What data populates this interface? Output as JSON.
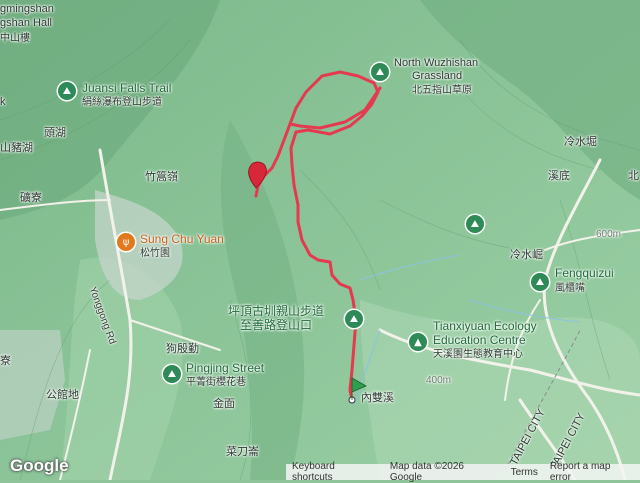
{
  "map": {
    "brand": "Google",
    "attribution": {
      "shortcuts": "Keyboard shortcuts",
      "data": "Map data ©2026 Google",
      "terms": "Terms",
      "report": "Report a map error"
    },
    "colors": {
      "track": "#e5394f",
      "start_flag": "#2e9e4f",
      "end_pin": "#d7283a",
      "terrain": "#8fc49b"
    }
  },
  "labels": [
    {
      "id": "nl-tl1",
      "text": "gmingshan",
      "cls": ""
    },
    {
      "id": "nl-tl2",
      "text": "gshan Hall",
      "cls": ""
    },
    {
      "id": "nl-tl3",
      "text": "中山樓",
      "cls": "sub"
    },
    {
      "id": "juansi-en",
      "text": "Juansi Falls Trail",
      "cls": "green"
    },
    {
      "id": "juansi-zh",
      "text": "絹絲瀑布登山步道",
      "cls": "sub"
    },
    {
      "id": "k",
      "text": "k",
      "cls": ""
    },
    {
      "id": "toukou",
      "text": "頭湖",
      "cls": ""
    },
    {
      "id": "shanzhuhu",
      "text": "山豬湖",
      "cls": ""
    },
    {
      "id": "zhugaoling",
      "text": "竹篙嶺",
      "cls": ""
    },
    {
      "id": "jianliao",
      "text": "礦寮",
      "cls": ""
    },
    {
      "id": "songzhu-en",
      "text": "Sung Chu Yuan",
      "cls": "orange"
    },
    {
      "id": "songzhu-zh",
      "text": "松竹園",
      "cls": "sub"
    },
    {
      "id": "yonggong",
      "text": "Yonggong Rd",
      "cls": ""
    },
    {
      "id": "liao",
      "text": "寮",
      "cls": ""
    },
    {
      "id": "goudianzong",
      "text": "狗殷勤",
      "cls": ""
    },
    {
      "id": "pingjing-en",
      "text": "Pingjing Street",
      "cls": "green"
    },
    {
      "id": "pingjing-zh",
      "text": "平菁街櫻花巷",
      "cls": "sub"
    },
    {
      "id": "jinmian",
      "text": "金面",
      "cls": ""
    },
    {
      "id": "gongguandi",
      "text": "公館地",
      "cls": ""
    },
    {
      "id": "caidaolun",
      "text": "菜刀崙",
      "cls": ""
    },
    {
      "id": "wuzhishan-en1",
      "text": "North Wuzhishan",
      "cls": ""
    },
    {
      "id": "wuzhishan-en2",
      "text": "Grassland",
      "cls": ""
    },
    {
      "id": "wuzhishan-zh",
      "text": "北五指山草原",
      "cls": "sub"
    },
    {
      "id": "lengshuiku",
      "text": "冷水堀",
      "cls": ""
    },
    {
      "id": "xidi",
      "text": "溪底",
      "cls": ""
    },
    {
      "id": "bei",
      "text": "北",
      "cls": ""
    },
    {
      "id": "lengshuijue",
      "text": "冷水崛",
      "cls": ""
    },
    {
      "id": "fengquizui-en",
      "text": "Fengquizui",
      "cls": "green"
    },
    {
      "id": "fengquizui-zh",
      "text": "風櫃嘴",
      "cls": "sub"
    },
    {
      "id": "pingding-1",
      "text": "坪頂古圳親山步道",
      "cls": "green"
    },
    {
      "id": "pingding-2",
      "text": "至善路登山口",
      "cls": "green"
    },
    {
      "id": "tianxi-en1",
      "text": "Tianxiyuan Ecology",
      "cls": "green"
    },
    {
      "id": "tianxi-en2",
      "text": "Education Centre",
      "cls": "green"
    },
    {
      "id": "tianxi-zh",
      "text": "天溪園生態教育中心",
      "cls": "sub"
    },
    {
      "id": "shuangxi",
      "text": "內雙溪",
      "cls": ""
    },
    {
      "id": "taipei1",
      "text": "TAIPEI CITY",
      "cls": ""
    },
    {
      "id": "taipei2",
      "text": "TAIPEI CITY",
      "cls": ""
    },
    {
      "id": "el-400",
      "text": "400m",
      "cls": "sub"
    },
    {
      "id": "el-600",
      "text": "600m",
      "cls": "sub"
    }
  ],
  "pois": [
    {
      "id": "poi-juansi",
      "icon": "hiking-icon",
      "glyph": "⛰",
      "color": "green"
    },
    {
      "id": "poi-wuzhishan",
      "icon": "hiking-icon",
      "glyph": "⛰",
      "color": "green"
    },
    {
      "id": "poi-songzhu",
      "icon": "restaurant-icon",
      "glyph": "ψ",
      "color": "orange"
    },
    {
      "id": "poi-pingjing",
      "icon": "hiking-icon",
      "glyph": "⛰",
      "color": "green"
    },
    {
      "id": "poi-east",
      "icon": "hiking-icon",
      "glyph": "⛰",
      "color": "green"
    },
    {
      "id": "poi-fengquizui",
      "icon": "hiking-icon",
      "glyph": "⛰",
      "color": "green"
    },
    {
      "id": "poi-tianxi",
      "icon": "park-icon",
      "glyph": "▲",
      "color": "green"
    },
    {
      "id": "poi-pingding",
      "icon": "hiking-icon",
      "glyph": "⛰",
      "color": "green"
    }
  ]
}
